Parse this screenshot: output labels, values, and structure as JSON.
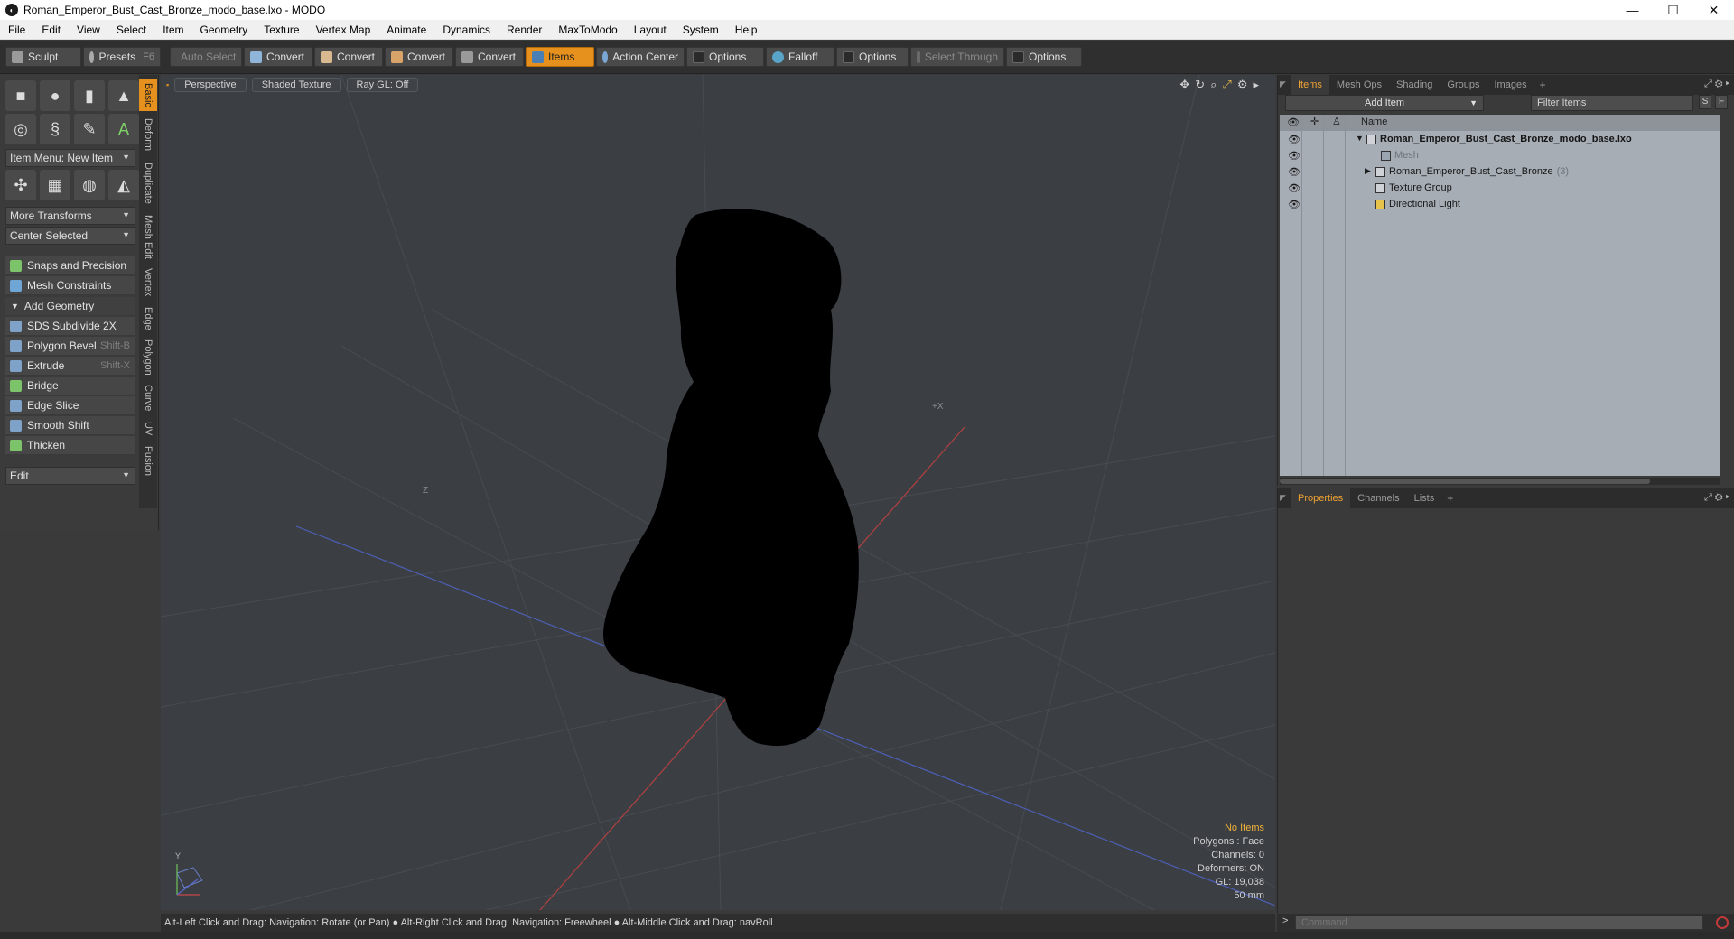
{
  "window": {
    "title": "Roman_Emperor_Bust_Cast_Bronze_modo_base.lxo - MODO",
    "app_icon": "modo-logo",
    "controls": [
      "minimize",
      "maximize",
      "close"
    ]
  },
  "menu": [
    "File",
    "Edit",
    "View",
    "Select",
    "Item",
    "Geometry",
    "Texture",
    "Vertex Map",
    "Animate",
    "Dynamics",
    "Render",
    "MaxToModo",
    "Layout",
    "System",
    "Help"
  ],
  "toolbar": {
    "sculpt": "Sculpt",
    "presets": "Presets",
    "presets_hotkey": "F6",
    "auto_select": "Auto Select",
    "convert_1": "Convert",
    "convert_2": "Convert",
    "convert_3": "Convert",
    "convert_4": "Convert",
    "items": "Items",
    "action_center": "Action Center",
    "options_1": "Options",
    "falloff": "Falloff",
    "options_2": "Options",
    "select_through": "Select Through",
    "options_3": "Options"
  },
  "left_panel": {
    "item_menu": "Item Menu: New Item",
    "more_transforms": "More Transforms",
    "center_selected": "Center Selected",
    "snaps": "Snaps and Precision",
    "mesh_constraints": "Mesh Constraints",
    "add_geometry": "Add Geometry",
    "tools": [
      {
        "label": "SDS Subdivide 2X",
        "hotkey": ""
      },
      {
        "label": "Polygon Bevel",
        "hotkey": "Shift-B"
      },
      {
        "label": "Extrude",
        "hotkey": "Shift-X"
      },
      {
        "label": "Bridge",
        "hotkey": ""
      },
      {
        "label": "Edge Slice",
        "hotkey": ""
      },
      {
        "label": "Smooth Shift",
        "hotkey": ""
      },
      {
        "label": "Thicken",
        "hotkey": ""
      }
    ],
    "edit_dropdown": "Edit",
    "vertical_tabs": [
      "Basic",
      "Deform",
      "Duplicate",
      "Mesh Edit",
      "Vertex",
      "Edge",
      "Polygon",
      "Curve",
      "UV",
      "Fusion"
    ]
  },
  "viewport": {
    "view_mode": "Perspective",
    "shading": "Shaded Texture",
    "raygl": "Ray GL: Off",
    "stats": {
      "selection": "No Items",
      "polygons": "Polygons : Face",
      "channels": "Channels: 0",
      "deformers": "Deformers: ON",
      "gl": "GL: 19,038",
      "scale": "50 mm"
    },
    "axis_label_x": "+X",
    "axis_label_z": "Z",
    "gizmo_y": "Y"
  },
  "status_bar": "Alt-Left Click and Drag: Navigation: Rotate (or Pan) ●  Alt-Right Click and Drag: Navigation: Freewheel ●  Alt-Middle Click and Drag: navRoll",
  "items_panel": {
    "tabs": [
      "Items",
      "Mesh Ops",
      "Shading",
      "Groups",
      "Images"
    ],
    "add_item": "Add Item",
    "filter_placeholder": "Filter Items",
    "s_btn": "S",
    "f_btn": "F",
    "column_name": "Name",
    "tree": [
      {
        "label": "Roman_Emperor_Bust_Cast_Bronze_modo_base.lxo",
        "bold": true
      },
      {
        "label": "Mesh",
        "dim": true
      },
      {
        "label": "Roman_Emperor_Bust_Cast_Bronze",
        "count": "(3)"
      },
      {
        "label": "Texture Group"
      },
      {
        "label": "Directional Light"
      }
    ]
  },
  "properties_panel": {
    "tabs": [
      "Properties",
      "Channels",
      "Lists"
    ]
  },
  "command": {
    "placeholder": "Command"
  },
  "colors": {
    "accent": "#e6911e",
    "viewport_bg": "#3b3f44",
    "tree_bg": "#a7adb5"
  }
}
